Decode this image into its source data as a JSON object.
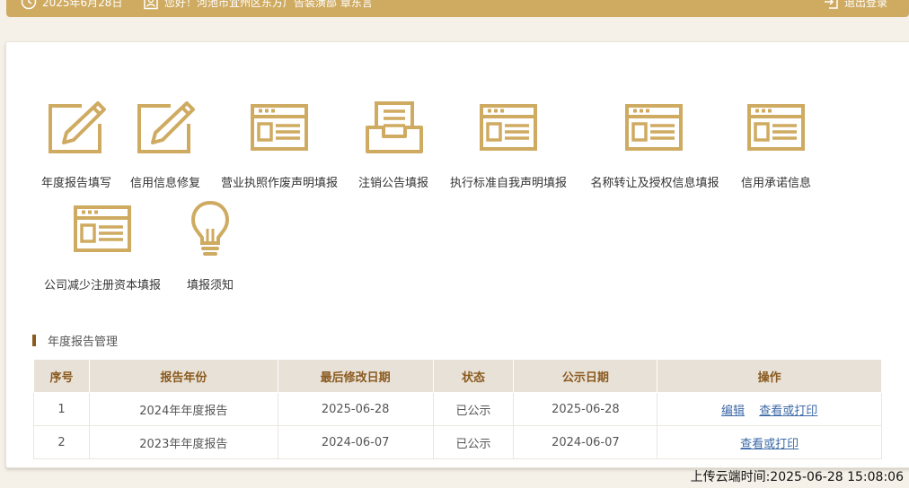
{
  "header": {
    "date": "2025年6月28日",
    "greeting": "您好！河池市宜州区东方广告装潢部 章东言",
    "logout_label": "退出登录"
  },
  "tiles": [
    {
      "label": "年度报告填写",
      "icon": "edit-pencil-icon"
    },
    {
      "label": "信用信息修复",
      "icon": "edit-pencil-icon"
    },
    {
      "label": "营业执照作废声明填报",
      "icon": "form-window-icon"
    },
    {
      "label": "注销公告填报",
      "icon": "inbox-tray-icon"
    },
    {
      "label": "执行标准自我声明填报",
      "icon": "form-window-icon"
    },
    {
      "label": "名称转让及授权信息填报",
      "icon": "form-window-icon"
    },
    {
      "label": "信用承诺信息",
      "icon": "form-window-icon"
    },
    {
      "label": "公司减少注册资本填报",
      "icon": "form-window-icon"
    },
    {
      "label": "填报须知",
      "icon": "lightbulb-icon"
    }
  ],
  "section": {
    "title": "年度报告管理"
  },
  "table": {
    "headers": [
      "序号",
      "报告年份",
      "最后修改日期",
      "状态",
      "公示日期",
      "操作"
    ],
    "rows": [
      {
        "no": "1",
        "year": "2024年年度报告",
        "modified": "2025-06-28",
        "status": "已公示",
        "published": "2025-06-28",
        "actions": [
          "编辑",
          "查看或打印"
        ]
      },
      {
        "no": "2",
        "year": "2023年年度报告",
        "modified": "2024-06-07",
        "status": "已公示",
        "published": "2024-06-07",
        "actions": [
          "查看或打印"
        ]
      }
    ]
  },
  "footer": {
    "upload_time": "上传云端时间:2025-06-28 15:08:06"
  },
  "colors": {
    "accent": "#cfab62",
    "header_text": "#8a5a1f",
    "link": "#3d6aa7",
    "table_head_bg": "#e8e1d7"
  }
}
